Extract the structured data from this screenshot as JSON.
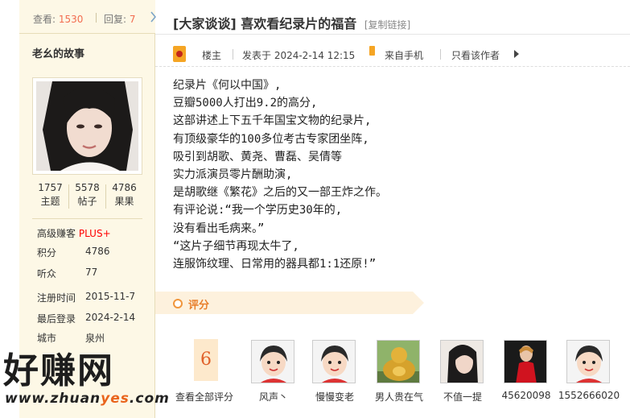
{
  "stats": {
    "view_label": "查看:",
    "views": "1530",
    "reply_label": "回复:",
    "replies": "7"
  },
  "author": {
    "name": "老幺的故事",
    "counts": [
      {
        "value": "1757",
        "label": "主题"
      },
      {
        "value": "5578",
        "label": "帖子"
      },
      {
        "value": "4786",
        "label": "果果"
      }
    ],
    "info": [
      {
        "label": "高级赚客",
        "value": "PLUS+"
      },
      {
        "label": "积分",
        "value": "4786"
      },
      {
        "label": "听众",
        "value": "77"
      },
      {
        "label": "注册时间",
        "value": "2015-11-7"
      },
      {
        "label": "最后登录",
        "value": "2024-2-14"
      },
      {
        "label": "城市",
        "value": "泉州"
      }
    ]
  },
  "watermark": {
    "main": "好赚网",
    "url_a": "www.zhuan",
    "url_b": "yes",
    "url_c": ".com"
  },
  "thread": {
    "forum": "[大家谈谈]",
    "title": "喜欢看纪录片的福音",
    "copy_link": "[复制链接]"
  },
  "meta": {
    "floor": "楼主",
    "posted_at": "发表于 2024-2-14 12:15",
    "source": "来自手机",
    "only_author": "只看该作者"
  },
  "content": [
    "纪录片《何以中国》,",
    "豆瓣5000人打出9.2的高分,",
    "这部讲述上下五千年国宝文物的纪录片,",
    "有顶级豪华的100多位考古专家团坐阵,",
    "吸引到胡歌、黄尧、曹磊、吴倩等",
    "实力派演员零片酬助演,",
    "是胡歌继《繁花》之后的又一部王炸之作。",
    "有评论说:“我一个学历史30年的,",
    "没有看出毛病来。”",
    "“这片子细节再现太牛了,",
    "连服饰纹理、日常用的器具都1:1还原!”"
  ],
  "rating": {
    "label": "评分",
    "count": "6",
    "view_all": "查看全部评分",
    "raters": [
      {
        "name": "风声丶",
        "avatar": "default-avatar"
      },
      {
        "name": "慢慢变老",
        "avatar": "default-avatar"
      },
      {
        "name": "男人贵在气",
        "avatar": "buddha-avatar"
      },
      {
        "name": "不值一提",
        "avatar": "woman-avatar"
      },
      {
        "name": "45620098",
        "avatar": "woman-red-dress-avatar"
      },
      {
        "name": "1552666020",
        "avatar": "default-avatar"
      }
    ]
  },
  "colors": {
    "accent": "#f26c4f",
    "panel_bg": "#fdf8e6",
    "rate_bar": "#fdf1dd",
    "plus": "#ff0000"
  }
}
